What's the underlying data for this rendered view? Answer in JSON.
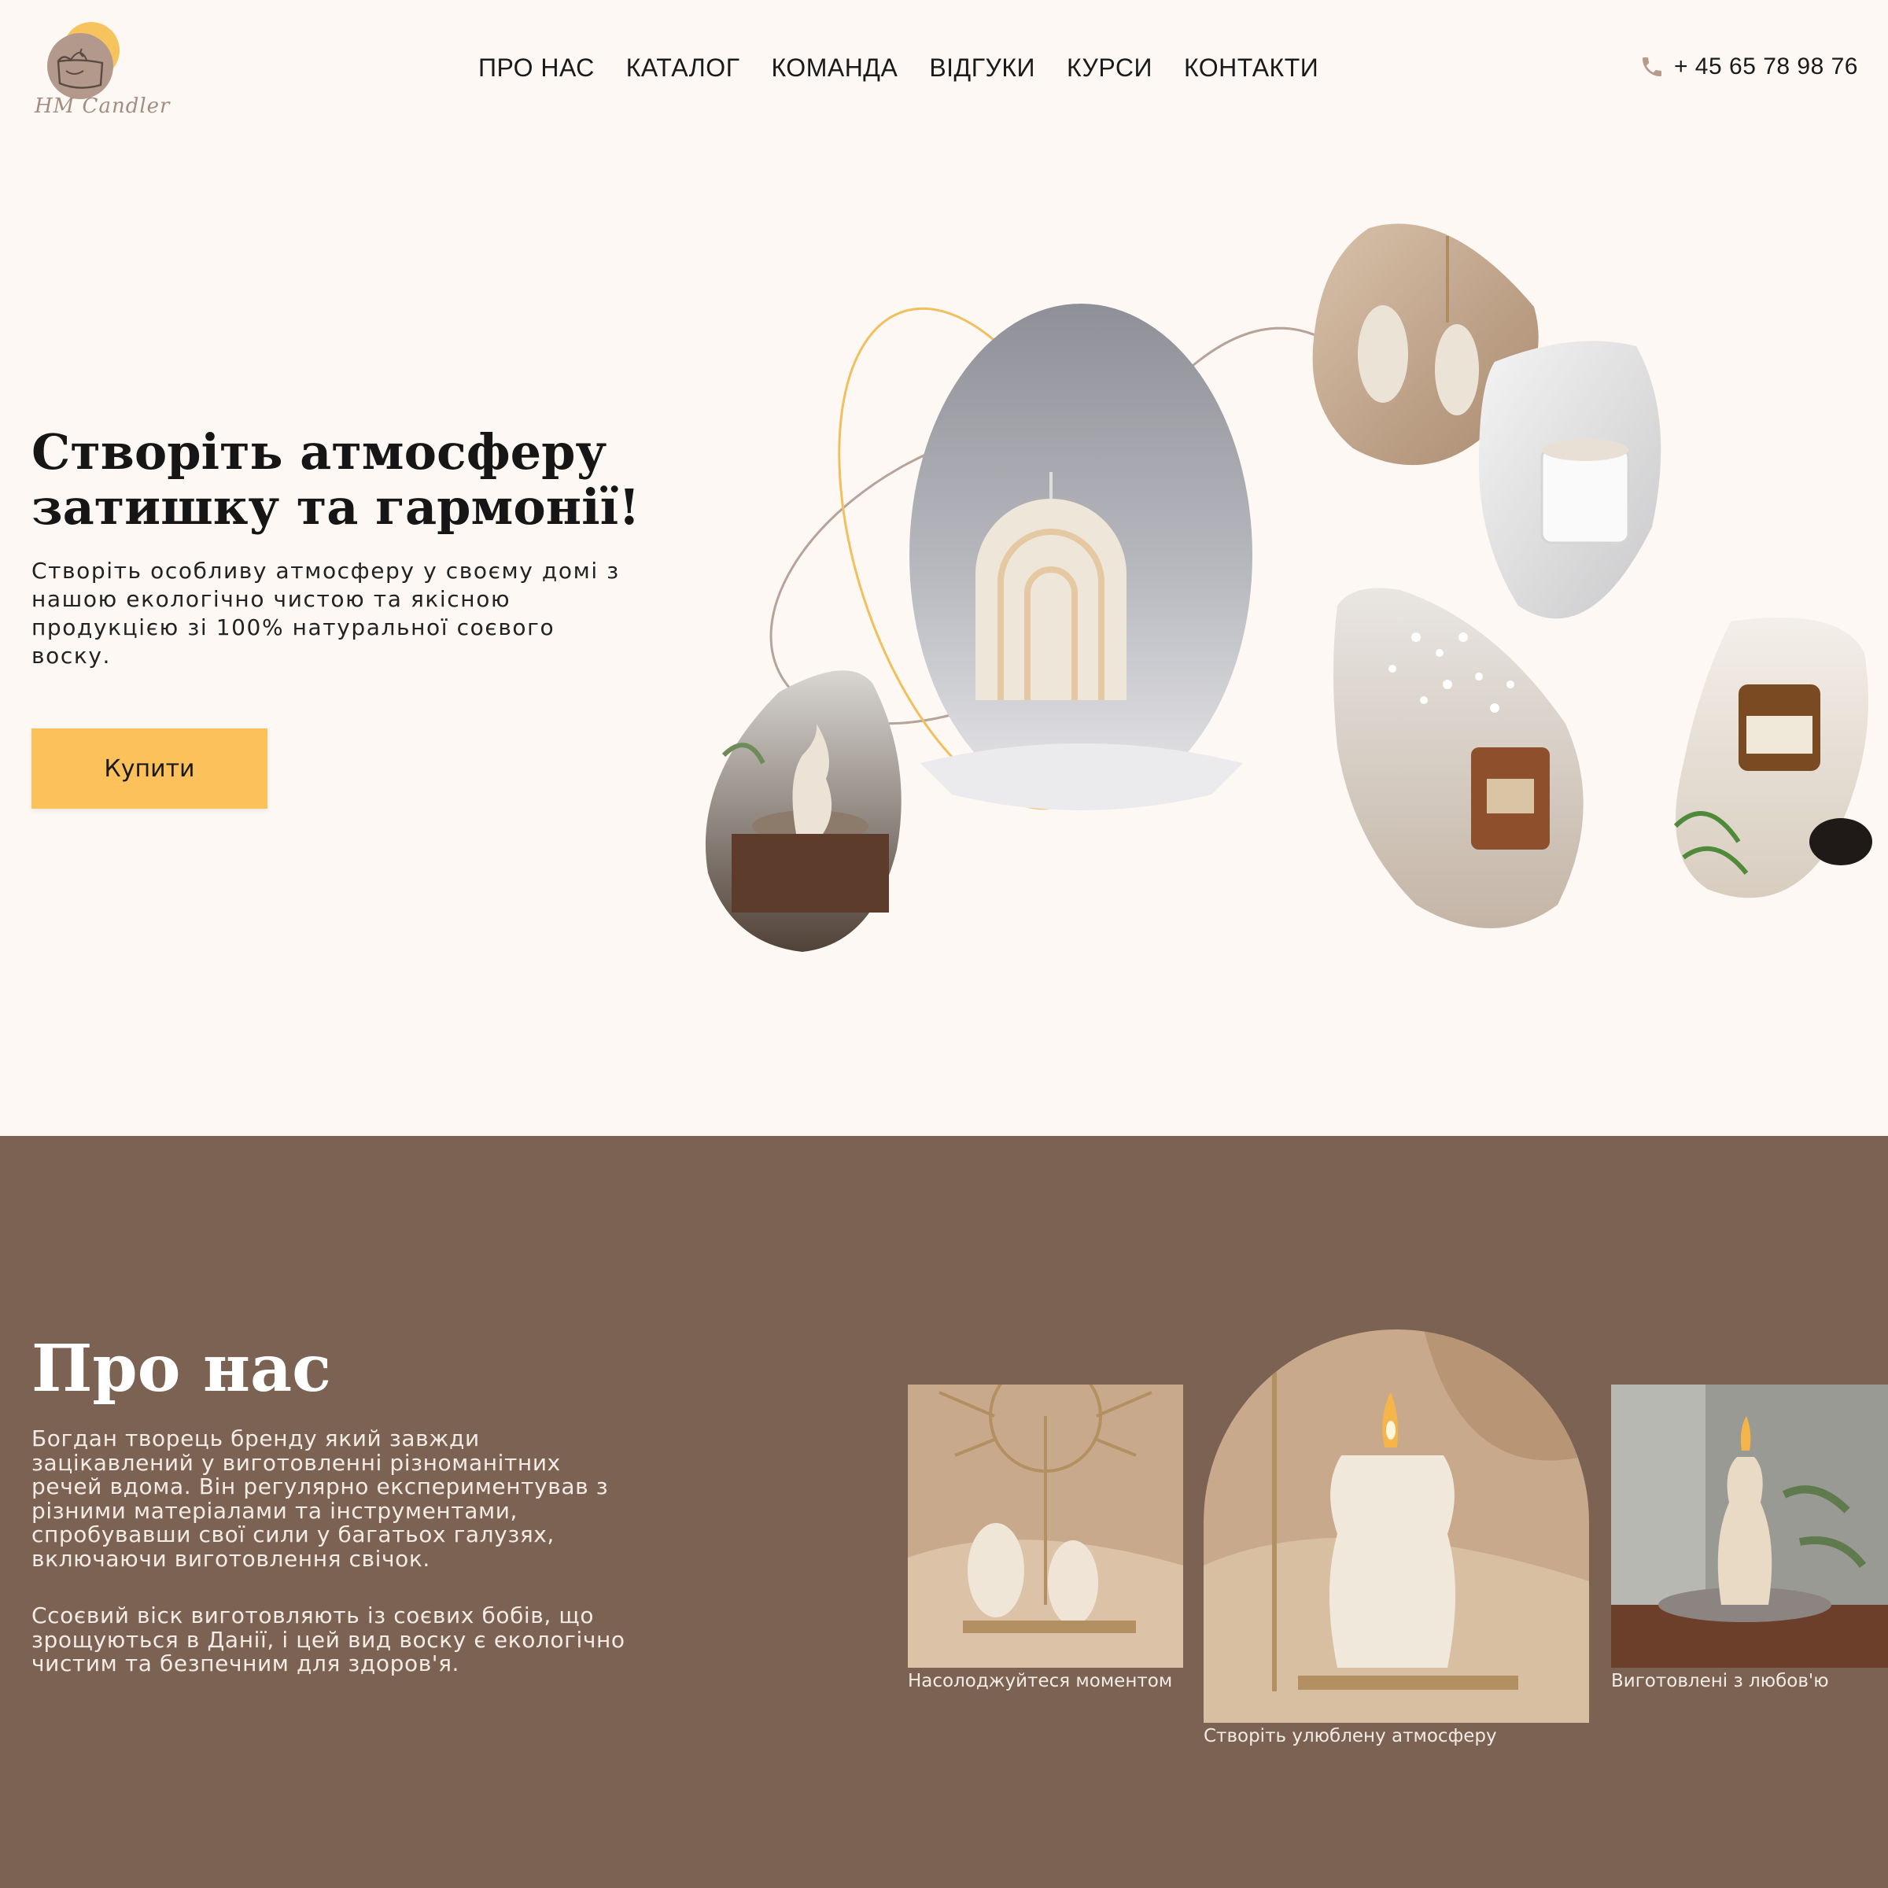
{
  "header": {
    "logo_text": "HM Candler",
    "nav": [
      "ПРО НАС",
      "КАТАЛОГ",
      "КОМАНДА",
      "ВІДГУКИ",
      "КУРСИ",
      "КОНТАКТИ"
    ],
    "phone": "+ 45 65 78 98 76"
  },
  "hero": {
    "title_line1": "Створіть атмосферу",
    "title_line2": "затишку та гармонії!",
    "description": "Створіть особливу атмосферу у своєму домі з нашою екологічно чистою та якісною продукцією зі 100% натуральної соєвого воску.",
    "buy_button": "Купити"
  },
  "about": {
    "title": "Про нас",
    "paragraph1": "Богдан творець бренду який завжди зацікавлений у виготовленні різноманітних речей вдома. Він регулярно експериментував з різними матеріалами та інструментами, спробувавши свої сили у багатьох галузях, включаючи виготовлення свічок.",
    "paragraph2": "Ссоєвий віск виготовляють із соєвих бобів, що зрощуються в Данії, і цей вид воску є екологічно чистим та безпечним для здоров'я.",
    "captions": [
      "Насолоджуйтеся моментом",
      "Створіть улюблену атмосферу",
      "Виготовлені з любов'ю"
    ]
  },
  "colors": {
    "background": "#fdf8f4",
    "accent": "#fdc15c",
    "about_bg": "#7b6253"
  }
}
